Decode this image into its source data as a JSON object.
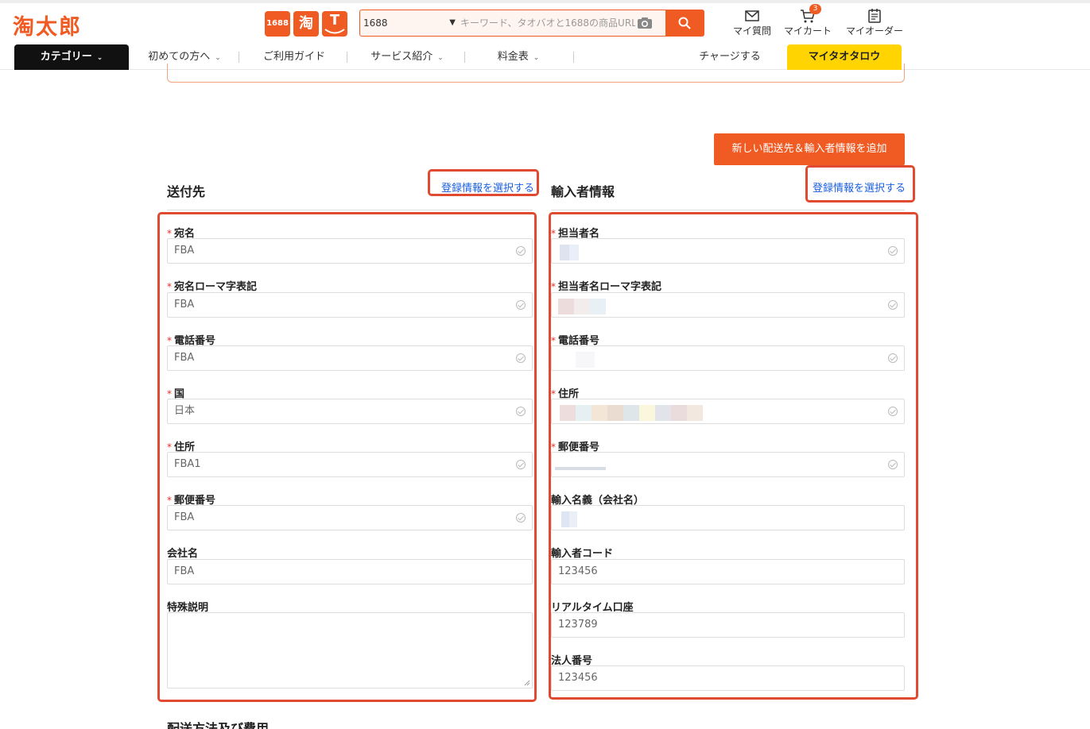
{
  "header": {
    "logo": "淘太郎",
    "brands": {
      "b1688": "1688",
      "taobao": "淘",
      "tmall": "T"
    },
    "search": {
      "source": "1688",
      "placeholder": "キーワード、タオバオと1688の商品URL"
    },
    "nav": {
      "question": "マイ質問",
      "cart": "マイカート",
      "cart_count": "3",
      "orders": "マイオーダー"
    }
  },
  "navbar": {
    "category": "カテゴリー",
    "items": [
      "初めての方へ",
      "ご利用ガイド",
      "サービス紹介",
      "料金表"
    ],
    "charge": "チャージする",
    "mypage": "マイタオタロウ"
  },
  "add_button": "新しい配送先＆輸入者情報を追加",
  "shipping": {
    "title": "送付先",
    "select_link": "登録情報を選択する",
    "fields": [
      {
        "label": "宛名",
        "value": "FBA"
      },
      {
        "label": "宛名ローマ字表記",
        "value": "FBA"
      },
      {
        "label": "電話番号",
        "value": "FBA"
      },
      {
        "label": "国",
        "value": "日本"
      },
      {
        "label": "住所",
        "value": "FBA1"
      },
      {
        "label": "郵便番号",
        "value": "FBA"
      },
      {
        "label": "会社名",
        "value": "FBA"
      },
      {
        "label": "特殊説明",
        "value": ""
      }
    ]
  },
  "importer": {
    "title": "輸入者情報",
    "select_link": "登録情報を選択する",
    "fields": [
      {
        "label": "担当者名",
        "value": ""
      },
      {
        "label": "担当者名ローマ字表記",
        "value": ""
      },
      {
        "label": "電話番号",
        "value": ""
      },
      {
        "label": "住所",
        "value": ""
      },
      {
        "label": "郵便番号",
        "value": ""
      },
      {
        "label": "輸入名義（会社名）",
        "value": ""
      },
      {
        "label": "輸入者コード",
        "value": "123456"
      },
      {
        "label": "リアルタイム口座",
        "value": "123789"
      },
      {
        "label": "法人番号",
        "value": "123456"
      }
    ]
  },
  "next_section": "配送方法及び費用",
  "colors": {
    "accent": "#f05a23",
    "highlight": "#ffd400",
    "link": "#1a5fe0",
    "annotation": "#e04a30"
  }
}
